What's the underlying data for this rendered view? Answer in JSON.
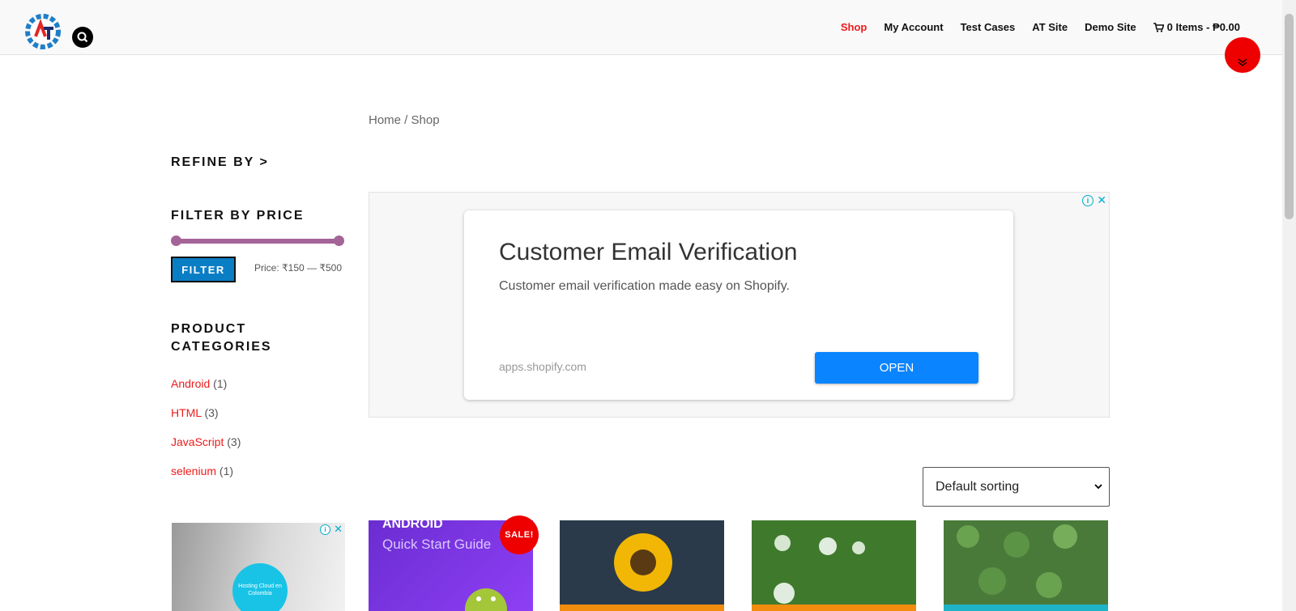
{
  "nav": {
    "items": [
      "Shop",
      "My Account",
      "Test Cases",
      "AT Site",
      "Demo Site"
    ],
    "cart": "0 Items - ₱0.00"
  },
  "breadcrumb": "Home / Shop",
  "sidebar": {
    "refine": "REFINE BY >",
    "filter_title": "FILTER BY PRICE",
    "filter_button": "FILTER",
    "price_label": "Price: ₹150 — ₹500",
    "categories_title": "PRODUCT CATEGORIES",
    "categories": [
      {
        "name": "Android",
        "count": "(1)"
      },
      {
        "name": "HTML",
        "count": "(3)"
      },
      {
        "name": "JavaScript",
        "count": "(3)"
      },
      {
        "name": "selenium",
        "count": "(1)"
      }
    ],
    "side_ad_text": "Hosting Cloud en Colombia"
  },
  "ad": {
    "headline": "Customer Email Verification",
    "description": "Customer email verification made easy on Shopify.",
    "url": "apps.shopify.com",
    "button": "OPEN"
  },
  "sort": {
    "selected": "Default sorting"
  },
  "products": {
    "sale_badge": "SALE!",
    "p1_title": "ANDROID",
    "p1_subtitle": "Quick Start Guide"
  },
  "colors": {
    "accent": "#ef1a1a",
    "filter_button": "#0a7ec5",
    "slider": "#a46497",
    "ad_button": "#0a85ff"
  }
}
